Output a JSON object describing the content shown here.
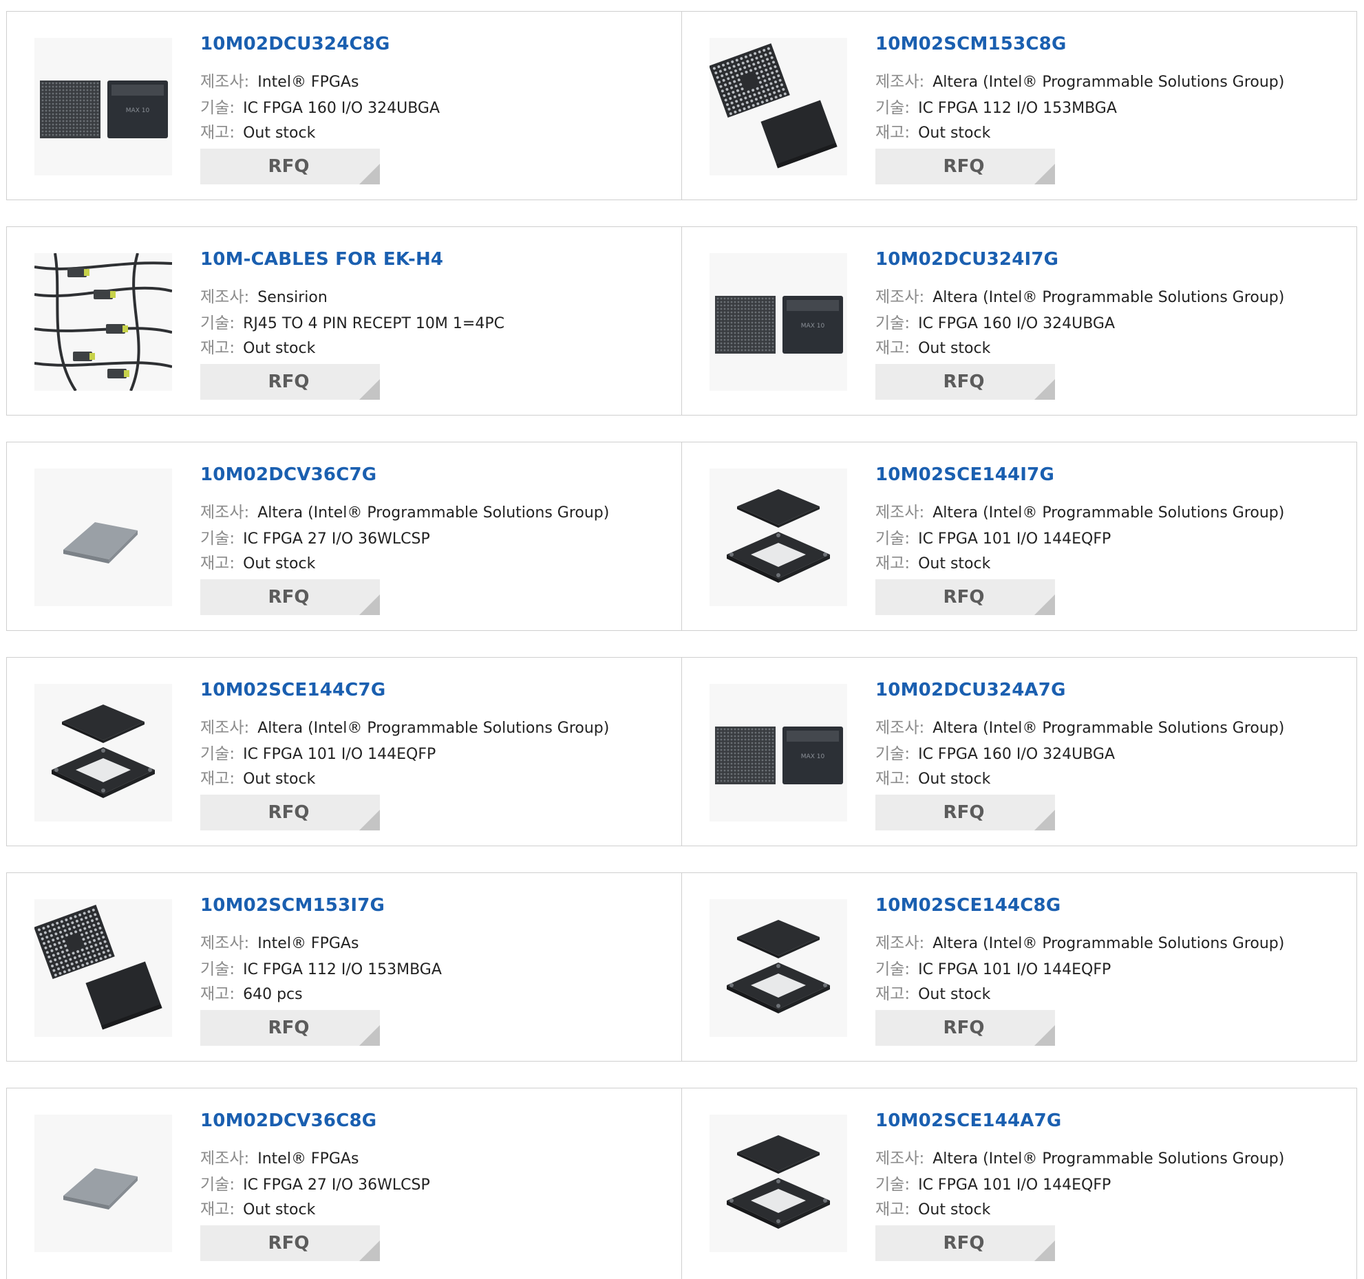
{
  "labels": {
    "manufacturer": "제조사:",
    "description": "기술:",
    "stock": "재고:",
    "button": "RFQ"
  },
  "colors": {
    "title": "#1a5fb0",
    "label": "#8a8a8a",
    "button_bg": "#ececec",
    "border": "#cfcfcf"
  },
  "products": [
    {
      "part": "10M02DCU324C8G",
      "manufacturer": "Intel® FPGAs",
      "description": "IC FPGA 160 I/O 324UBGA",
      "stock": "Out stock",
      "image": "bga-pair"
    },
    {
      "part": "10M02SCM153C8G",
      "manufacturer": "Altera (Intel® Programmable Solutions Group)",
      "description": "IC FPGA 112 I/O 153MBGA",
      "stock": "Out stock",
      "image": "mbga-tilted"
    },
    {
      "part": "10M-CABLES FOR EK-H4",
      "manufacturer": "Sensirion",
      "description": "RJ45 TO 4 PIN RECEPT 10M 1=4PC",
      "stock": "Out stock",
      "image": "cables"
    },
    {
      "part": "10M02DCU324I7G",
      "manufacturer": "Altera (Intel® Programmable Solutions Group)",
      "description": "IC FPGA 160 I/O 324UBGA",
      "stock": "Out stock",
      "image": "bga-pair"
    },
    {
      "part": "10M02DCV36C7G",
      "manufacturer": "Altera (Intel® Programmable Solutions Group)",
      "description": "IC FPGA 27 I/O 36WLCSP",
      "stock": "Out stock",
      "image": "wlcsp"
    },
    {
      "part": "10M02SCE144I7G",
      "manufacturer": "Altera (Intel® Programmable Solutions Group)",
      "description": "IC FPGA 101 I/O 144EQFP",
      "stock": "Out stock",
      "image": "eqfp"
    },
    {
      "part": "10M02SCE144C7G",
      "manufacturer": "Altera (Intel® Programmable Solutions Group)",
      "description": "IC FPGA 101 I/O 144EQFP",
      "stock": "Out stock",
      "image": "eqfp"
    },
    {
      "part": "10M02DCU324A7G",
      "manufacturer": "Altera (Intel® Programmable Solutions Group)",
      "description": "IC FPGA 160 I/O 324UBGA",
      "stock": "Out stock",
      "image": "bga-pair"
    },
    {
      "part": "10M02SCM153I7G",
      "manufacturer": "Intel® FPGAs",
      "description": "IC FPGA 112 I/O 153MBGA",
      "stock": "640 pcs",
      "image": "mbga-tilted"
    },
    {
      "part": "10M02SCE144C8G",
      "manufacturer": "Altera (Intel® Programmable Solutions Group)",
      "description": "IC FPGA 101 I/O 144EQFP",
      "stock": "Out stock",
      "image": "eqfp"
    },
    {
      "part": "10M02DCV36C8G",
      "manufacturer": "Intel® FPGAs",
      "description": "IC FPGA 27 I/O 36WLCSP",
      "stock": "Out stock",
      "image": "wlcsp"
    },
    {
      "part": "10M02SCE144A7G",
      "manufacturer": "Altera (Intel® Programmable Solutions Group)",
      "description": "IC FPGA 101 I/O 144EQFP",
      "stock": "Out stock",
      "image": "eqfp"
    }
  ]
}
